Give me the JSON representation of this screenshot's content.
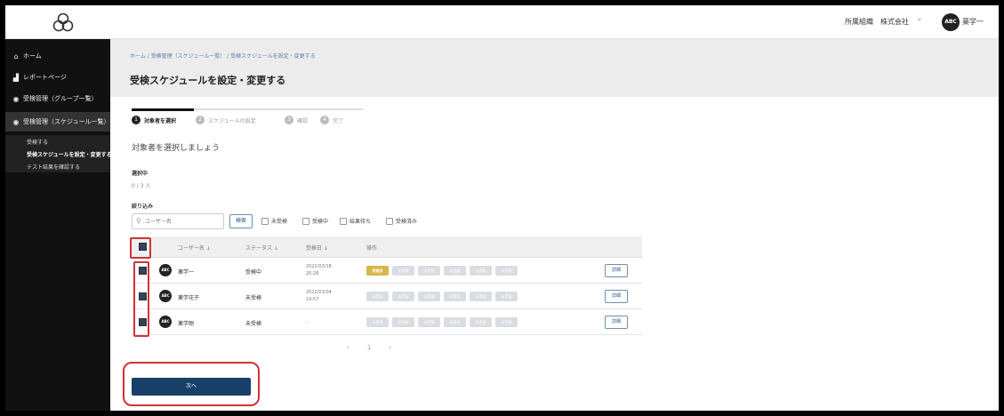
{
  "header": {
    "org_name": "所属組織　株式会社",
    "org_chevron": "⌄",
    "user_avatar": "ABC",
    "user_name": "薬学一"
  },
  "sidebar": {
    "items": [
      {
        "icon": "⌂",
        "label": "ホーム"
      },
      {
        "icon": "▟",
        "label": "レポートページ"
      },
      {
        "icon": "◉",
        "label": "受検管理（グループ一覧）"
      },
      {
        "icon": "◉",
        "label": "受検管理（スケジュール一覧）"
      }
    ],
    "subitems": [
      {
        "label": "受検する"
      },
      {
        "label": "受検スケジュールを設定・変更する"
      },
      {
        "label": "テスト結果を確認する"
      }
    ]
  },
  "page": {
    "breadcrumb": "ホーム / 受検管理（スケジュール一覧） / 受検スケジュールを設定・変更する",
    "title": "受検スケジュールを設定・変更する"
  },
  "stepper": {
    "steps": [
      {
        "num": "1",
        "label": "対象者を選択"
      },
      {
        "num": "2",
        "label": "スケジュールの設定"
      },
      {
        "num": "3",
        "label": "確認"
      },
      {
        "num": "4",
        "label": "完了"
      }
    ]
  },
  "form": {
    "prompt": "対象者を選択しましょう",
    "target_label": "選択中",
    "target_value": "0 / 3 人",
    "filter_label": "絞り込み",
    "search_placeholder": "ユーザー名",
    "search_button": "検索",
    "filters": [
      "未受検",
      "受検中",
      "結果待ち",
      "受検済み"
    ]
  },
  "table": {
    "headers": [
      "ユーザー名 ↓",
      "ステータス ↓",
      "受検日 ↓",
      "操作"
    ],
    "rows": [
      {
        "avatar": "ABC",
        "name": "薬学一",
        "status": "受検中",
        "date1": "2022/03/18",
        "date2": "20:28",
        "chips": [
          "受検済",
          "未受検",
          "未受検",
          "未受検",
          "未受検",
          "未受検"
        ],
        "done": [
          true,
          false,
          false,
          false,
          false,
          false
        ],
        "action": "詳細"
      },
      {
        "avatar": "ABC",
        "name": "薬学花子",
        "status": "未受検",
        "date1": "2022/03/04",
        "date2": "19:57",
        "chips": [
          "未受検",
          "未受検",
          "未受検",
          "未受検",
          "未受検",
          "未受検"
        ],
        "done": [
          false,
          false,
          false,
          false,
          false,
          false
        ],
        "action": "詳細"
      },
      {
        "avatar": "ABC",
        "name": "薬学剛",
        "status": "未受検",
        "date1": "-",
        "date2": "",
        "chips": [
          "未受検",
          "未受検",
          "未受検",
          "未受検",
          "未受検",
          "未受検"
        ],
        "done": [
          false,
          false,
          false,
          false,
          false,
          false
        ],
        "action": "詳細"
      }
    ]
  },
  "pagination": {
    "prev": "‹",
    "page": "1",
    "next": "›"
  },
  "next_button": "次へ",
  "colors": {
    "highlight": "#d0323a",
    "primary": "#173f68",
    "done_chip": "#d6b84a"
  }
}
